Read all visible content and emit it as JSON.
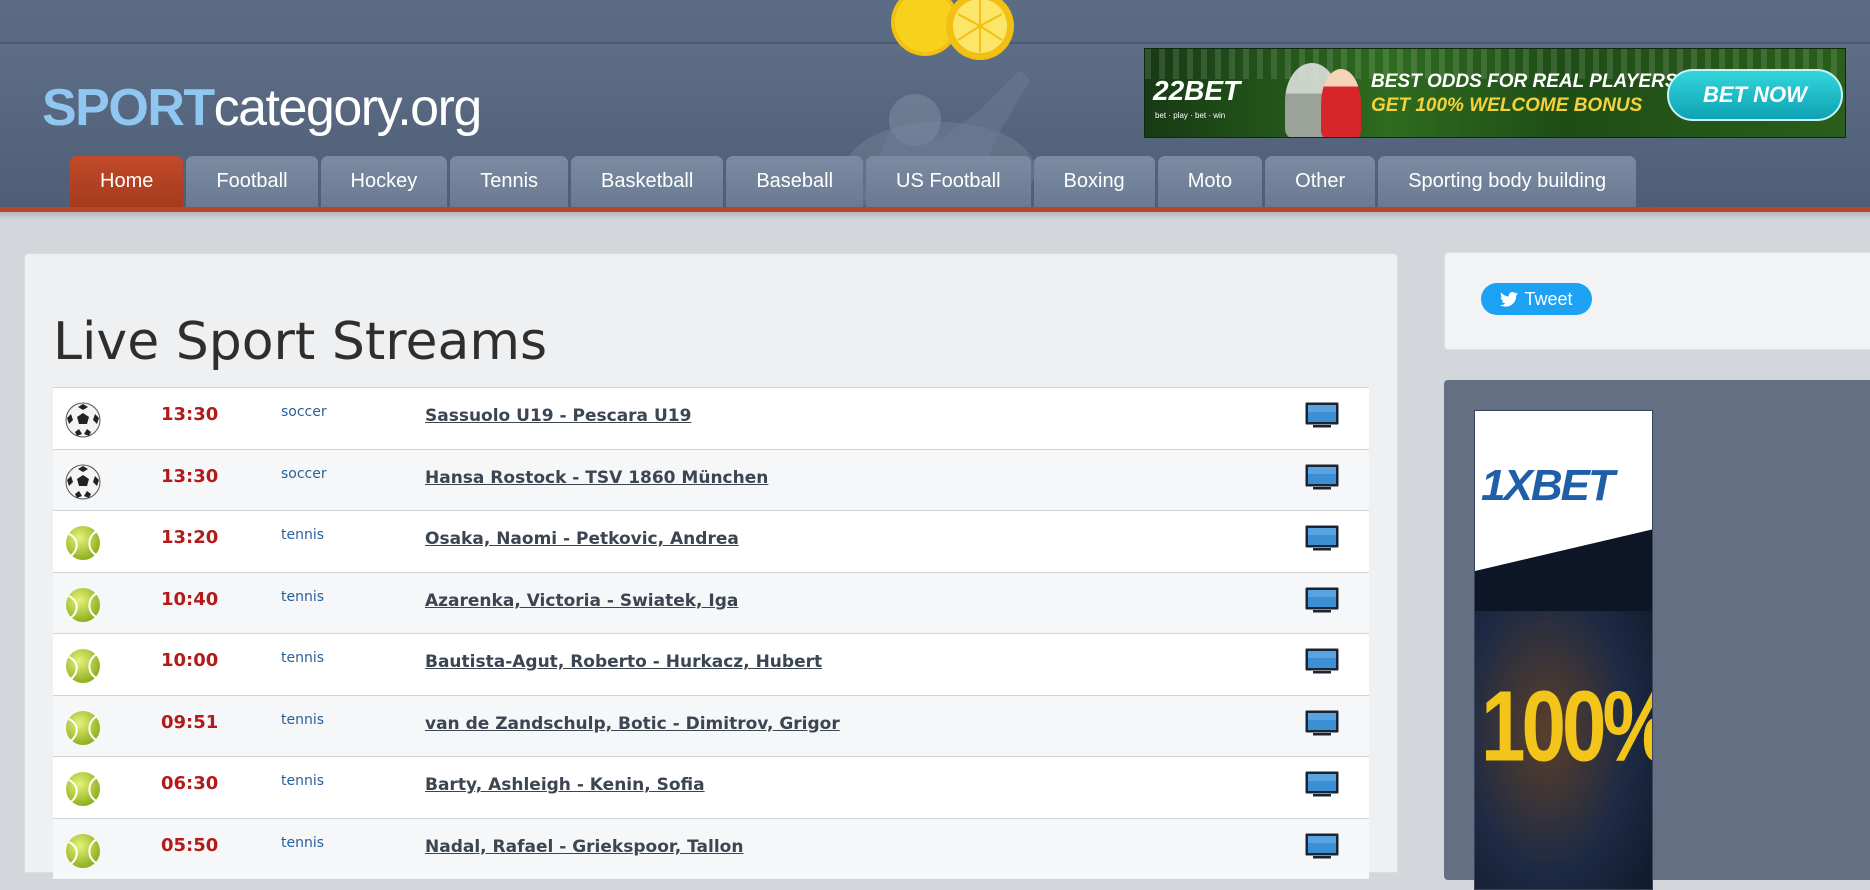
{
  "header": {
    "logo_bold": "SPORT",
    "logo_rest": "category.org"
  },
  "banner_ad": {
    "brand": "22BET",
    "brand_sub": "bet · play · bet · win",
    "headline": "BEST ODDS FOR REAL PLAYERS",
    "bonus": "GET 100% WELCOME BONUS",
    "cta": "BET NOW"
  },
  "nav": {
    "tabs": [
      {
        "label": "Home",
        "active": true
      },
      {
        "label": "Football"
      },
      {
        "label": "Hockey"
      },
      {
        "label": "Tennis"
      },
      {
        "label": "Basketball"
      },
      {
        "label": "Baseball"
      },
      {
        "label": "US Football"
      },
      {
        "label": "Boxing"
      },
      {
        "label": "Moto"
      },
      {
        "label": "Other"
      },
      {
        "label": "Sporting body building"
      }
    ]
  },
  "main": {
    "title": "Live Sport Streams",
    "streams": [
      {
        "time": "13:30",
        "sport": "soccer",
        "match": "Sassuolo U19 - Pescara U19",
        "icon": "soccer-ball-icon"
      },
      {
        "time": "13:30",
        "sport": "soccer",
        "match": "Hansa Rostock - TSV 1860 München",
        "icon": "soccer-ball-icon"
      },
      {
        "time": "13:20",
        "sport": "tennis",
        "match": "Osaka, Naomi - Petkovic, Andrea",
        "icon": "tennis-ball-icon"
      },
      {
        "time": "10:40",
        "sport": "tennis",
        "match": "Azarenka, Victoria - Swiatek, Iga",
        "icon": "tennis-ball-icon"
      },
      {
        "time": "10:00",
        "sport": "tennis",
        "match": "Bautista-Agut, Roberto - Hurkacz, Hubert",
        "icon": "tennis-ball-icon"
      },
      {
        "time": "09:51",
        "sport": "tennis",
        "match": "van de Zandschulp, Botic - Dimitrov, Grigor",
        "icon": "tennis-ball-icon"
      },
      {
        "time": "06:30",
        "sport": "tennis",
        "match": "Barty, Ashleigh - Kenin, Sofia",
        "icon": "tennis-ball-icon"
      },
      {
        "time": "05:50",
        "sport": "tennis",
        "match": "Nadal, Rafael - Griekspoor, Tallon",
        "icon": "tennis-ball-icon"
      }
    ]
  },
  "sidebar": {
    "tweet_label": "Tweet",
    "ad": {
      "brand": "1XBET",
      "percent": "100%"
    }
  },
  "colors": {
    "accent": "#b8442a",
    "time": "#b31b1b",
    "sport_link": "#2a5f9a",
    "twitter": "#1da1f2"
  }
}
